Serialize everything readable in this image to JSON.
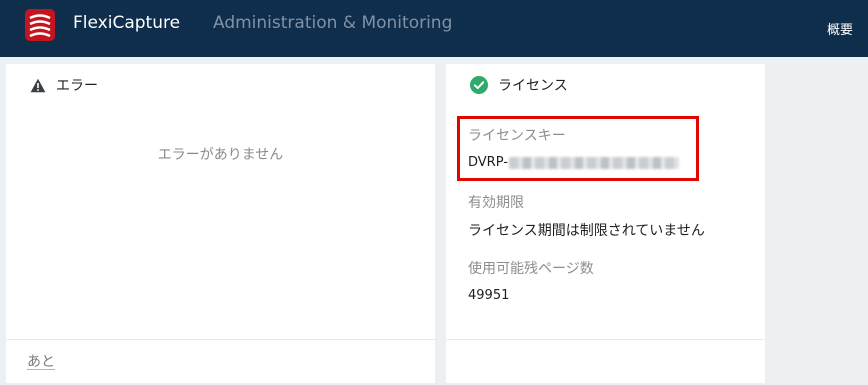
{
  "header": {
    "brand": "FlexiCapture",
    "subtitle": "Administration & Monitoring",
    "nav_right": "概要",
    "logo_icon": "flexicapture-logo-icon",
    "logo_color": "#c5141f",
    "bar_color": "#0e2e4c"
  },
  "errors_card": {
    "icon": "warning-icon",
    "title": "エラー",
    "empty_message": "エラーがありません",
    "footer_link": "あと"
  },
  "license_card": {
    "icon": "check-circle-icon",
    "icon_color": "#2eaa6a",
    "title": "ライセンス",
    "key_label": "ライセンスキー",
    "key_prefix": "DVRP-",
    "expiry_label": "有効期限",
    "expiry_value": "ライセンス期間は制限されていません",
    "pages_label": "使用可能残ページ数",
    "pages_value": "49951",
    "highlight_color": "#e10600"
  }
}
